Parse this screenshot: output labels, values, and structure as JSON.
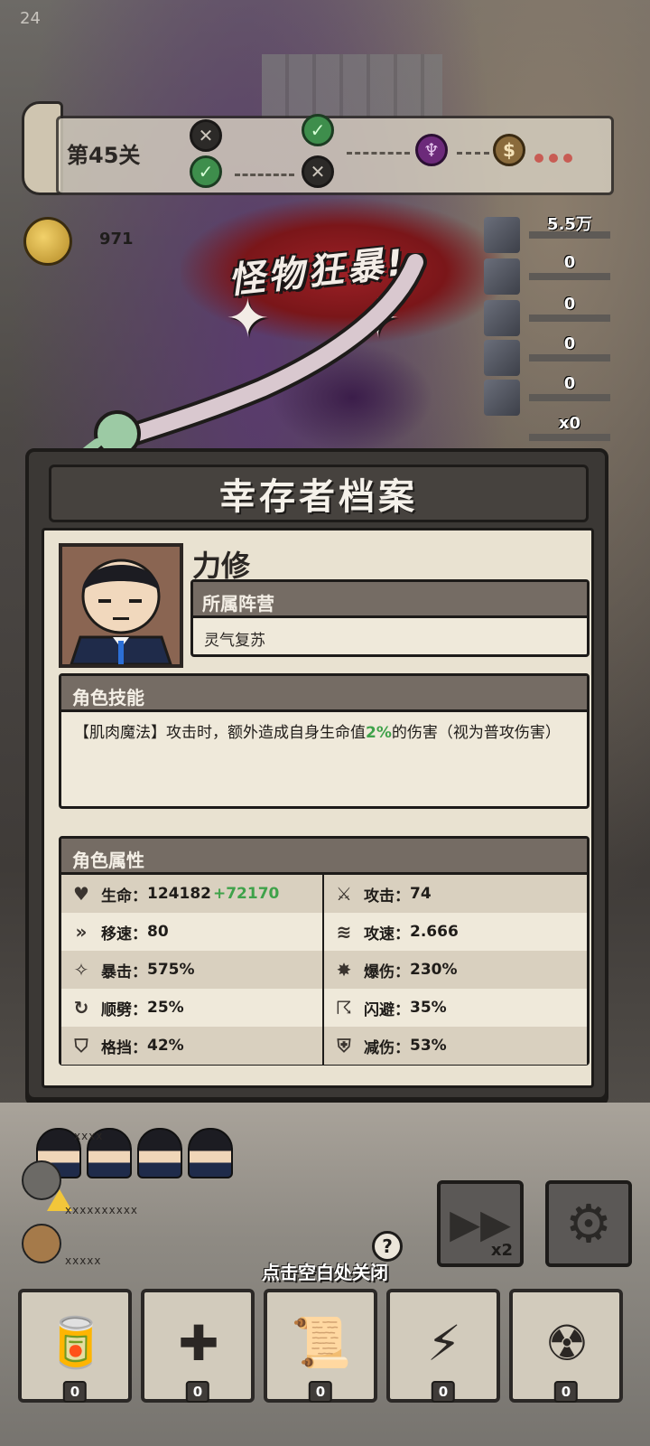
{
  "status": {
    "time": "24"
  },
  "level": {
    "label": "第45关",
    "nodes": [
      {
        "type": "locked",
        "icon": "crossed-swords-icon"
      },
      {
        "type": "cleared",
        "icon": "checkmark-icon"
      },
      {
        "type": "cleared",
        "icon": "checkmark-icon"
      },
      {
        "type": "locked",
        "icon": "crossed-swords-icon"
      },
      {
        "type": "boss",
        "icon": "boss-demon-icon"
      },
      {
        "type": "chest",
        "icon": "money-bag-icon"
      }
    ]
  },
  "coins": {
    "value": "971"
  },
  "event": {
    "banner": "怪物狂暴!"
  },
  "enemies": [
    {
      "count": "5.5万"
    },
    {
      "count": "0"
    },
    {
      "count": "0"
    },
    {
      "count": "0"
    },
    {
      "count": "0"
    },
    {
      "count": "x0"
    }
  ],
  "modal": {
    "title": "幸存者档案",
    "character": {
      "name": "力修",
      "faction_label": "所属阵营",
      "faction_value": "灵气复苏"
    },
    "skill": {
      "heading": "角色技能",
      "text_before": "【肌肉魔法】攻击时，额外造成自身生命值",
      "highlight": "2%",
      "text_after": "的伤害（视为普攻伤害）"
    },
    "attributes": {
      "heading": "角色属性",
      "rows": [
        {
          "left_icon": "heart-icon",
          "left_label": "生命：",
          "left_value": "124182",
          "left_bonus": "+72170",
          "right_icon": "sword-icon",
          "right_label": "攻击：",
          "right_value": "74"
        },
        {
          "left_icon": "speed-icon",
          "left_label": "移速：",
          "left_value": "80",
          "right_icon": "attack-speed-icon",
          "right_label": "攻速：",
          "right_value": "2.666"
        },
        {
          "left_icon": "crit-icon",
          "left_label": "暴击：",
          "left_value": "575%",
          "right_icon": "crit-damage-icon",
          "right_label": "爆伤：",
          "right_value": "230%"
        },
        {
          "left_icon": "cleave-icon",
          "left_label": "顺劈：",
          "left_value": "25%",
          "right_icon": "dodge-icon",
          "right_label": "闪避：",
          "right_value": "35%"
        },
        {
          "left_icon": "shield-icon",
          "left_label": "格挡：",
          "left_value": "42%",
          "right_icon": "damage-reduction-icon",
          "right_label": "减伤：",
          "right_value": "53%"
        }
      ]
    }
  },
  "pets": [
    {
      "label": "xxxxxxxxxx"
    },
    {
      "label": "xxxxx"
    }
  ],
  "team": {
    "labels": [
      "xxxx"
    ]
  },
  "hint": {
    "close_tip": "点击空白处关闭"
  },
  "controls": {
    "speed_multiplier": "x2"
  },
  "items": [
    {
      "name": "cola-can-icon",
      "count": "0"
    },
    {
      "name": "first-aid-kit-icon",
      "count": "0"
    },
    {
      "name": "scroll-map-icon",
      "count": "0"
    },
    {
      "name": "paper-talisman-icon",
      "count": "0"
    },
    {
      "name": "nuke-bomb-icon",
      "count": "0"
    }
  ],
  "colors": {
    "accent_green": "#3fa24a",
    "panel_dark": "#3b3835",
    "paper": "#e9e2d1",
    "header_brown": "#756c64"
  }
}
